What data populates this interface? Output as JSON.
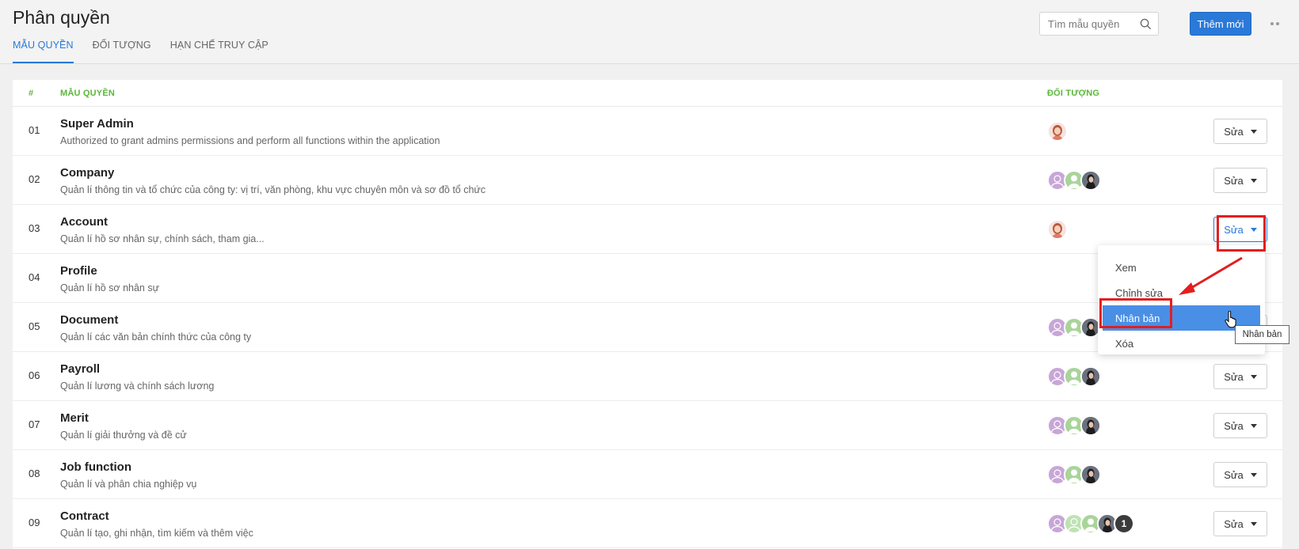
{
  "header": {
    "title": "Phân quyền",
    "tabs": [
      {
        "label": "MẪU QUYỀN",
        "active": true
      },
      {
        "label": "ĐỐI TƯỢNG",
        "active": false
      },
      {
        "label": "HẠN CHẾ TRUY CẬP",
        "active": false
      }
    ],
    "search_placeholder": "Tìm mẫu quyền",
    "add_button": "Thêm mới"
  },
  "table": {
    "columns": [
      "#",
      "MẪU QUYỀN",
      "ĐỐI TƯỢNG"
    ],
    "edit_label": "Sửa",
    "rows": [
      {
        "num": "01",
        "name": "Super Admin",
        "desc": "Authorized to grant admins permissions and perform all functions within the application",
        "avatars": [
          "woman"
        ]
      },
      {
        "num": "02",
        "name": "Company",
        "desc": "Quản lí thông tin và tổ chức của công ty: vị trí, văn phòng, khu vực chuyên môn và sơ đồ tổ chức",
        "avatars": [
          "purple",
          "green",
          "photo"
        ]
      },
      {
        "num": "03",
        "name": "Account",
        "desc": "Quản lí hồ sơ nhân sự, chính sách, tham gia...",
        "avatars": [
          "woman"
        ]
      },
      {
        "num": "04",
        "name": "Profile",
        "desc": "Quản lí hồ sơ nhân sự",
        "avatars": []
      },
      {
        "num": "05",
        "name": "Document",
        "desc": "Quản lí các văn bản chính thức của công ty",
        "avatars": [
          "purple",
          "green",
          "photo"
        ]
      },
      {
        "num": "06",
        "name": "Payroll",
        "desc": "Quản lí lương và chính sách lương",
        "avatars": [
          "purple",
          "green",
          "photo"
        ]
      },
      {
        "num": "07",
        "name": "Merit",
        "desc": "Quản lí giải thưởng và đề cử",
        "avatars": [
          "purple",
          "green",
          "photo"
        ]
      },
      {
        "num": "08",
        "name": "Job function",
        "desc": "Quản lí và phân chia nghiệp vụ",
        "avatars": [
          "purple",
          "green",
          "photo"
        ]
      },
      {
        "num": "09",
        "name": "Contract",
        "desc": "Quản lí tạo, ghi nhận, tìm kiếm và thêm việc",
        "avatars": [
          "purple",
          "green2",
          "green",
          "photo",
          "count"
        ],
        "extra_count": "1"
      }
    ]
  },
  "dropdown": {
    "items": [
      "Xem",
      "Chỉnh sửa",
      "Nhân bản",
      "Xóa"
    ],
    "active_item": "Nhân bản"
  },
  "tooltip": "Nhân bản",
  "colors": {
    "accent": "#2a79d8",
    "column_header": "#5ab837",
    "annotation": "#e41e1e",
    "menu_highlight": "#4a8fe6"
  }
}
